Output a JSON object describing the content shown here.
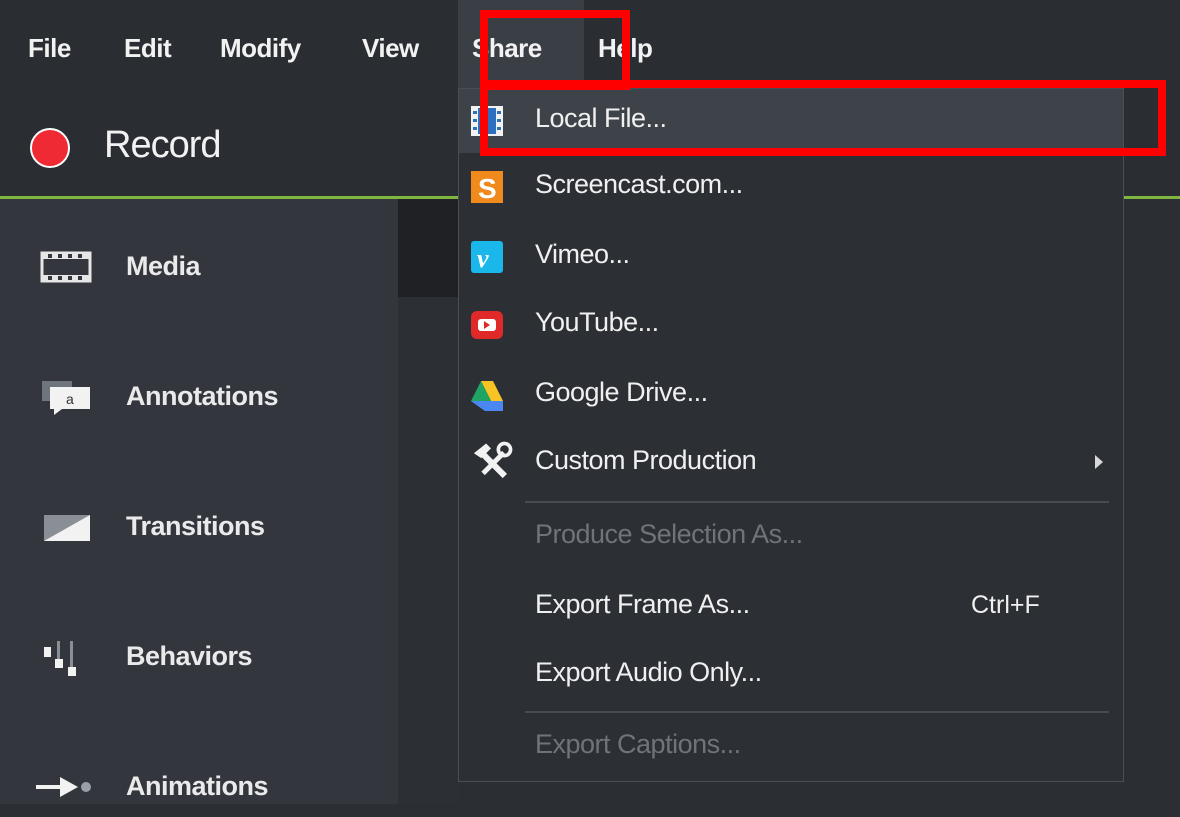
{
  "menubar": {
    "items": [
      {
        "label": "File"
      },
      {
        "label": "Edit"
      },
      {
        "label": "Modify"
      },
      {
        "label": "View"
      },
      {
        "label": "Share"
      },
      {
        "label": "Help"
      }
    ],
    "active": "Share"
  },
  "record": {
    "label": "Record"
  },
  "sidebar": {
    "items": [
      {
        "label": "Media",
        "icon": "film-strip-icon"
      },
      {
        "label": "Annotations",
        "icon": "speech-bubble-icon"
      },
      {
        "label": "Transitions",
        "icon": "transition-icon"
      },
      {
        "label": "Behaviors",
        "icon": "behaviors-icon"
      },
      {
        "label": "Animations",
        "icon": "arrow-right-icon"
      }
    ]
  },
  "share_menu": {
    "items": [
      {
        "label": "Local File...",
        "icon": "film-icon",
        "highlighted": true
      },
      {
        "label": "Screencast.com...",
        "icon": "screencast-icon"
      },
      {
        "label": "Vimeo...",
        "icon": "vimeo-icon"
      },
      {
        "label": "YouTube...",
        "icon": "youtube-icon"
      },
      {
        "label": "Google Drive...",
        "icon": "google-drive-icon"
      },
      {
        "label": "Custom Production",
        "icon": "tools-icon",
        "submenu": true
      },
      {
        "label": "Produce Selection As...",
        "disabled": true
      },
      {
        "label": "Export Frame As...",
        "shortcut": "Ctrl+F"
      },
      {
        "label": "Export Audio Only..."
      },
      {
        "label": "Export Captions...",
        "disabled": true
      }
    ]
  },
  "colors": {
    "accent_green": "#7fb640",
    "record_red": "#ef2a34",
    "annotation_red": "#ff0000"
  }
}
